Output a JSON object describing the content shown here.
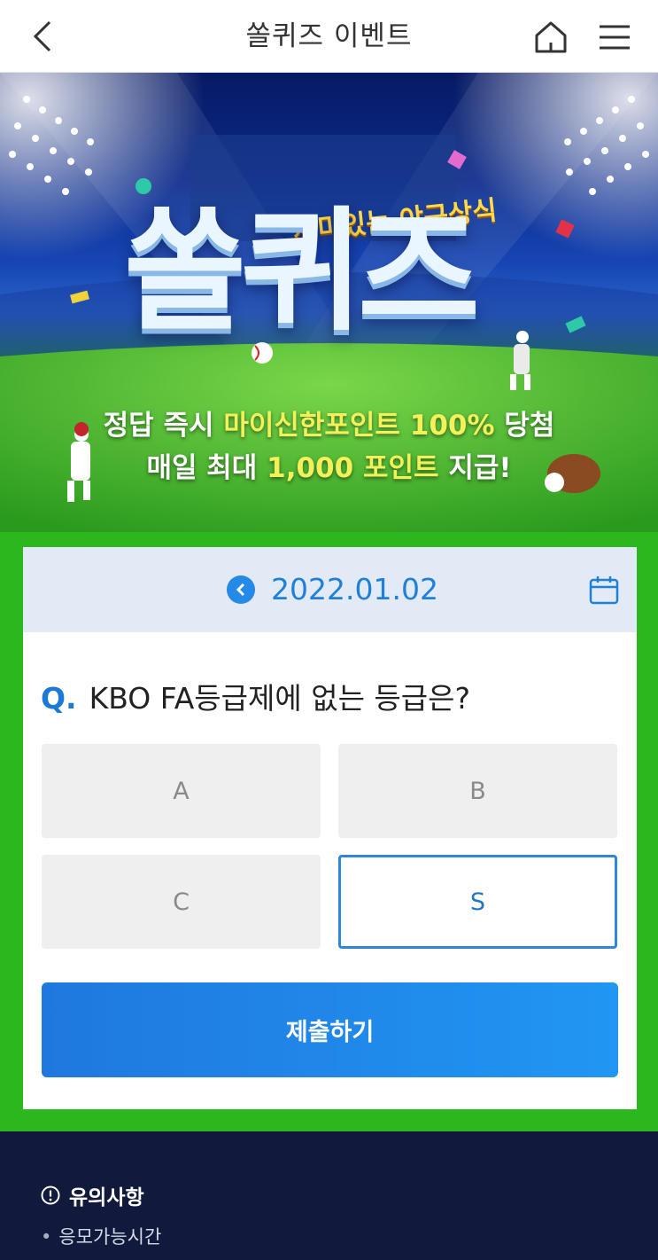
{
  "header": {
    "title": "쏠퀴즈 이벤트",
    "back_icon": "chevron-left-icon",
    "home_icon": "home-icon",
    "menu_icon": "hamburger-menu-icon"
  },
  "banner": {
    "subtitle": "재미있는 야구상식",
    "title": "쏠퀴즈",
    "line1_before": "정답 즉시 ",
    "line1_highlight": "마이신한포인트 100%",
    "line1_after": " 당첨",
    "line2_before": "매일 최대 ",
    "line2_highlight": "1,000 포인트",
    "line2_after": " 지급!"
  },
  "quiz": {
    "date": "2022.01.02",
    "prev_icon": "chevron-left-circle-icon",
    "calendar_icon": "calendar-icon",
    "q_label": "Q.",
    "question": "KBO FA등급제에 없는 등급은?",
    "options": [
      "A",
      "B",
      "C",
      "S"
    ],
    "selected": "S",
    "submit_label": "제출하기"
  },
  "notice": {
    "title": "유의사항",
    "icon": "info-circle-icon",
    "items": [
      "응모가능시간"
    ]
  },
  "colors": {
    "accent": "#2589e8",
    "green": "#2db71f",
    "highlight": "#f3f05a",
    "notice_bg": "#111a3d"
  }
}
